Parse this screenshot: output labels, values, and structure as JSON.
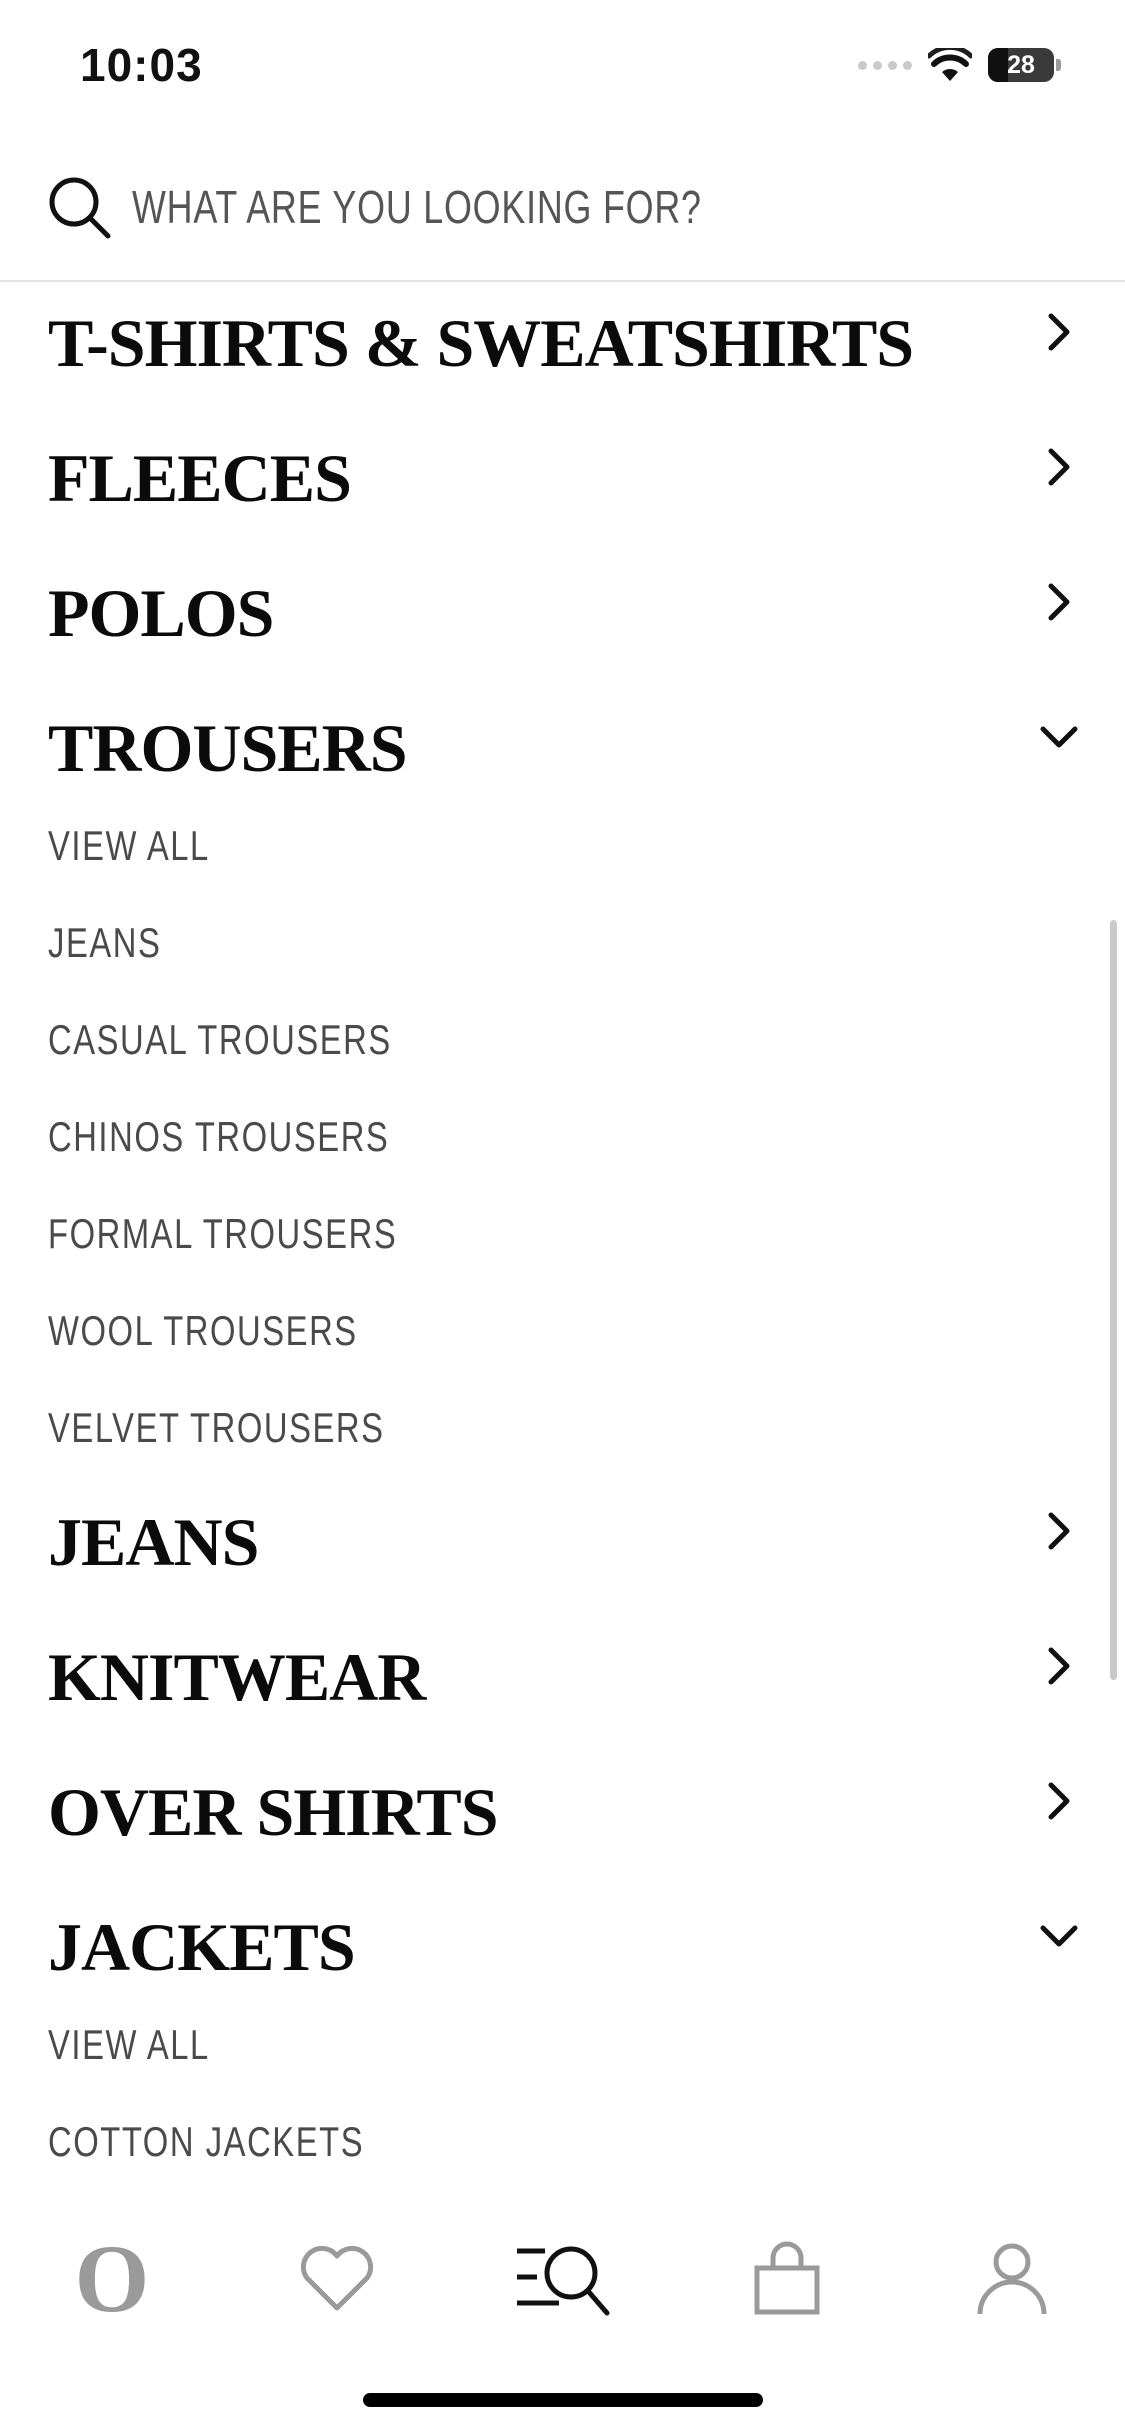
{
  "status_bar": {
    "time": "10:03",
    "battery": "28"
  },
  "search": {
    "placeholder": "WHAT ARE YOU LOOKING FOR?"
  },
  "menu": {
    "categories": [
      {
        "label": "T-SHIRTS & SWEATSHIRTS",
        "state": "collapsed"
      },
      {
        "label": "FLEECES",
        "state": "collapsed"
      },
      {
        "label": "POLOS",
        "state": "collapsed"
      },
      {
        "label": "TROUSERS",
        "state": "expanded",
        "items": [
          "VIEW ALL",
          "JEANS",
          "CASUAL TROUSERS",
          "CHINOS TROUSERS",
          "FORMAL TROUSERS",
          "WOOL TROUSERS",
          "VELVET TROUSERS"
        ]
      },
      {
        "label": "JEANS",
        "state": "collapsed"
      },
      {
        "label": "KNITWEAR",
        "state": "collapsed"
      },
      {
        "label": "OVER SHIRTS",
        "state": "collapsed"
      },
      {
        "label": "JACKETS",
        "state": "expanded",
        "items": [
          "VIEW ALL",
          "COTTON JACKETS"
        ]
      }
    ]
  },
  "tab_bar": {
    "tabs": [
      {
        "name": "home",
        "icon": "brand-logo-icon",
        "active": false,
        "logo_text": "O"
      },
      {
        "name": "wishlist",
        "icon": "heart-icon",
        "active": false
      },
      {
        "name": "browse",
        "icon": "menu-search-icon",
        "active": true
      },
      {
        "name": "bag",
        "icon": "bag-icon",
        "active": false
      },
      {
        "name": "account",
        "icon": "user-icon",
        "active": false
      }
    ]
  },
  "colors": {
    "text_dark": "#0b0b0b",
    "text_sub": "#4a4a4a",
    "icon_inactive": "#9a9a9a",
    "icon_active": "#111111"
  }
}
